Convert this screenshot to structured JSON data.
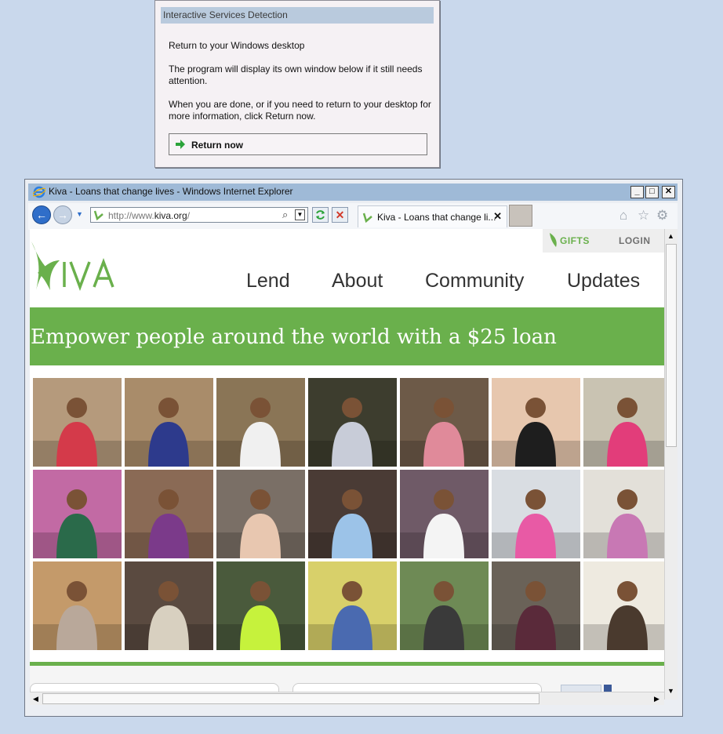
{
  "dialog": {
    "title": "Interactive Services Detection",
    "line1": "Return to your Windows desktop",
    "line2": "The program will display its own window below if it still needs attention.",
    "line3": "When you are done, or if you need to return to your desktop for more information, click Return now.",
    "button_label": "Return now"
  },
  "browser": {
    "window_title": "Kiva - Loans that change lives - Windows Internet Explorer",
    "address_prefix": "http://www.",
    "address_domain": "kiva.org",
    "address_suffix": "/",
    "tab_title": "Kiva - Loans that change li...",
    "tab_close": "✕",
    "minimize": "_",
    "maximize": "□",
    "close": "✕"
  },
  "page": {
    "brand": "KIVA",
    "gifts_label": "GIFTS",
    "login_label": "LOGIN",
    "nav": [
      "Lend",
      "About",
      "Community",
      "Updates"
    ],
    "banner_text": "Empower people around the world with a $25 loan"
  },
  "photos": [
    {
      "name": "borrower-photo-1",
      "bg": "#b59a7c",
      "accent": "#d43a4a"
    },
    {
      "name": "borrower-photo-2",
      "bg": "#a98c6a",
      "accent": "#2d3a8c"
    },
    {
      "name": "borrower-photo-3",
      "bg": "#8a7556",
      "accent": "#f0f0f0"
    },
    {
      "name": "borrower-photo-4",
      "bg": "#3d3d2e",
      "accent": "#c8ccd8"
    },
    {
      "name": "borrower-photo-5",
      "bg": "#6d5a48",
      "accent": "#e08a9a"
    },
    {
      "name": "borrower-photo-6",
      "bg": "#e7c7ae",
      "accent": "#1e1e1e"
    },
    {
      "name": "borrower-photo-7",
      "bg": "#c9c3b2",
      "accent": "#e23d7a"
    },
    {
      "name": "borrower-photo-8",
      "bg": "#c26aa4",
      "accent": "#2a6a4a"
    },
    {
      "name": "borrower-photo-9",
      "bg": "#8a6a55",
      "accent": "#7b3a8a"
    },
    {
      "name": "borrower-photo-10",
      "bg": "#7a6f66",
      "accent": "#e8c7b0"
    },
    {
      "name": "borrower-photo-11",
      "bg": "#4a3b35",
      "accent": "#9cc3e8"
    },
    {
      "name": "borrower-photo-12",
      "bg": "#6f5a67",
      "accent": "#f4f4f4"
    },
    {
      "name": "borrower-photo-13",
      "bg": "#d9dde2",
      "accent": "#e85aa5"
    },
    {
      "name": "borrower-photo-14",
      "bg": "#e3e0d9",
      "accent": "#c878b4"
    },
    {
      "name": "borrower-photo-15",
      "bg": "#c49a6a",
      "accent": "#b9a89a"
    },
    {
      "name": "borrower-photo-16",
      "bg": "#5a4a40",
      "accent": "#d8d0c0"
    },
    {
      "name": "borrower-photo-17",
      "bg": "#4a5a3c",
      "accent": "#c6f23c"
    },
    {
      "name": "borrower-photo-18",
      "bg": "#d8d06a",
      "accent": "#4a6ab0"
    },
    {
      "name": "borrower-photo-19",
      "bg": "#6e8a55",
      "accent": "#3a3a3a"
    },
    {
      "name": "borrower-photo-20",
      "bg": "#6a6258",
      "accent": "#5a2a3a"
    },
    {
      "name": "borrower-photo-21",
      "bg": "#eeeae0",
      "accent": "#4a3a2e"
    }
  ],
  "colors": {
    "kiva_green": "#6ab04c",
    "ie_title_bar": "#9fbad7",
    "desktop": "#c9d8ec"
  }
}
